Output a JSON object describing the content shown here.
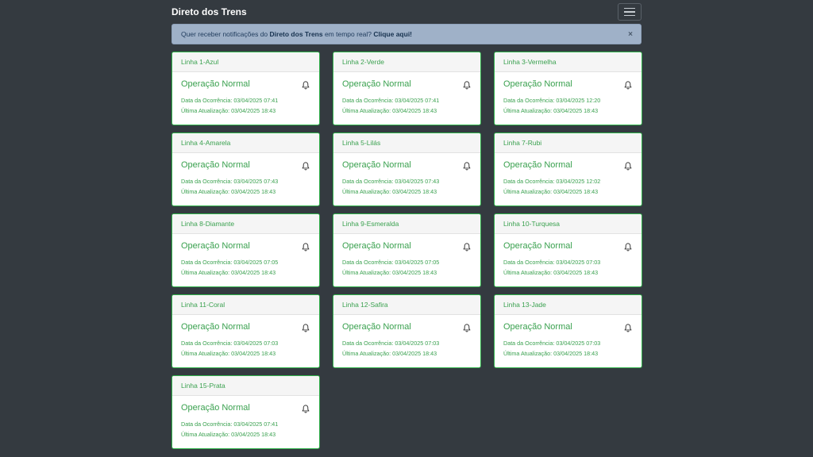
{
  "brand": "Direto dos Trens",
  "alert": {
    "text_before": "Quer receber notificações do ",
    "brand": "Direto dos Trens",
    "text_after": " em tempo real? ",
    "link": "Clique aqui!",
    "close": "×"
  },
  "labels": {
    "occurrence": "Data da Ocorrência: ",
    "update": "Última Atualização: "
  },
  "colors": {
    "background": "#343a40",
    "status_green": "#3aa14f",
    "alert_bg": "#9fb1c8"
  },
  "cards": [
    {
      "line": "Linha 1-Azul",
      "status": "Operação Normal",
      "occurrence": "03/04/2025 07:41",
      "update": "03/04/2025 18:43"
    },
    {
      "line": "Linha 2-Verde",
      "status": "Operação Normal",
      "occurrence": "03/04/2025 07:41",
      "update": "03/04/2025 18:43"
    },
    {
      "line": "Linha 3-Vermelha",
      "status": "Operação Normal",
      "occurrence": "03/04/2025 12:20",
      "update": "03/04/2025 18:43"
    },
    {
      "line": "Linha 4-Amarela",
      "status": "Operação Normal",
      "occurrence": "03/04/2025 07:43",
      "update": "03/04/2025 18:43"
    },
    {
      "line": "Linha 5-Lilás",
      "status": "Operação Normal",
      "occurrence": "03/04/2025 07:43",
      "update": "03/04/2025 18:43"
    },
    {
      "line": "Linha 7-Rubi",
      "status": "Operação Normal",
      "occurrence": "03/04/2025 12:02",
      "update": "03/04/2025 18:43"
    },
    {
      "line": "Linha 8-Diamante",
      "status": "Operação Normal",
      "occurrence": "03/04/2025 07:05",
      "update": "03/04/2025 18:43"
    },
    {
      "line": "Linha 9-Esmeralda",
      "status": "Operação Normal",
      "occurrence": "03/04/2025 07:05",
      "update": "03/04/2025 18:43"
    },
    {
      "line": "Linha 10-Turquesa",
      "status": "Operação Normal",
      "occurrence": "03/04/2025 07:03",
      "update": "03/04/2025 18:43"
    },
    {
      "line": "Linha 11-Coral",
      "status": "Operação Normal",
      "occurrence": "03/04/2025 07:03",
      "update": "03/04/2025 18:43"
    },
    {
      "line": "Linha 12-Safira",
      "status": "Operação Normal",
      "occurrence": "03/04/2025 07:03",
      "update": "03/04/2025 18:43"
    },
    {
      "line": "Linha 13-Jade",
      "status": "Operação Normal",
      "occurrence": "03/04/2025 07:03",
      "update": "03/04/2025 18:43"
    },
    {
      "line": "Linha 15-Prata",
      "status": "Operação Normal",
      "occurrence": "03/04/2025 07:41",
      "update": "03/04/2025 18:43"
    }
  ]
}
